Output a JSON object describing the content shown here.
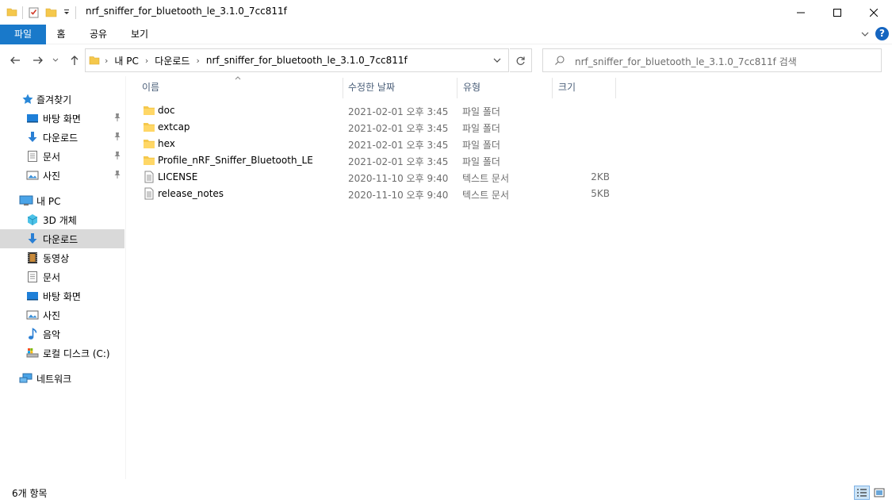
{
  "window": {
    "title": "nrf_sniffer_for_bluetooth_le_3.1.0_7cc811f"
  },
  "ribbon": {
    "tabs": [
      "파일",
      "홈",
      "공유",
      "보기"
    ],
    "help": "?"
  },
  "address": {
    "crumbs": [
      "내 PC",
      "다운로드",
      "nrf_sniffer_for_bluetooth_le_3.1.0_7cc811f"
    ]
  },
  "search": {
    "placeholder": "nrf_sniffer_for_bluetooth_le_3.1.0_7cc811f 검색"
  },
  "sidebar": {
    "quick_access": "즐겨찾기",
    "quick_items": [
      "바탕 화면",
      "다운로드",
      "문서",
      "사진"
    ],
    "this_pc": "내 PC",
    "pc_items": [
      "3D 개체",
      "다운로드",
      "동영상",
      "문서",
      "바탕 화면",
      "사진",
      "음악",
      "로컬 디스크 (C:)"
    ],
    "network": "네트워크",
    "selected": "다운로드"
  },
  "columns": {
    "name": "이름",
    "date": "수정한 날짜",
    "type": "유형",
    "size": "크기"
  },
  "files": [
    {
      "name": "doc",
      "date": "2021-02-01 오후 3:45",
      "type": "파일 폴더",
      "size": "",
      "icon": "folder-icon"
    },
    {
      "name": "extcap",
      "date": "2021-02-01 오후 3:45",
      "type": "파일 폴더",
      "size": "",
      "icon": "folder-icon"
    },
    {
      "name": "hex",
      "date": "2021-02-01 오후 3:45",
      "type": "파일 폴더",
      "size": "",
      "icon": "folder-icon"
    },
    {
      "name": "Profile_nRF_Sniffer_Bluetooth_LE",
      "date": "2021-02-01 오후 3:45",
      "type": "파일 폴더",
      "size": "",
      "icon": "folder-icon"
    },
    {
      "name": "LICENSE",
      "date": "2020-11-10 오후 9:40",
      "type": "텍스트 문서",
      "size": "2KB",
      "icon": "text-file-icon"
    },
    {
      "name": "release_notes",
      "date": "2020-11-10 오후 9:40",
      "type": "텍스트 문서",
      "size": "5KB",
      "icon": "text-file-icon"
    }
  ],
  "status": {
    "item_count": "6개 항목"
  },
  "colors": {
    "accent": "#1979ca",
    "folder": "#f5c84c",
    "selection": "#d9d9d9"
  }
}
